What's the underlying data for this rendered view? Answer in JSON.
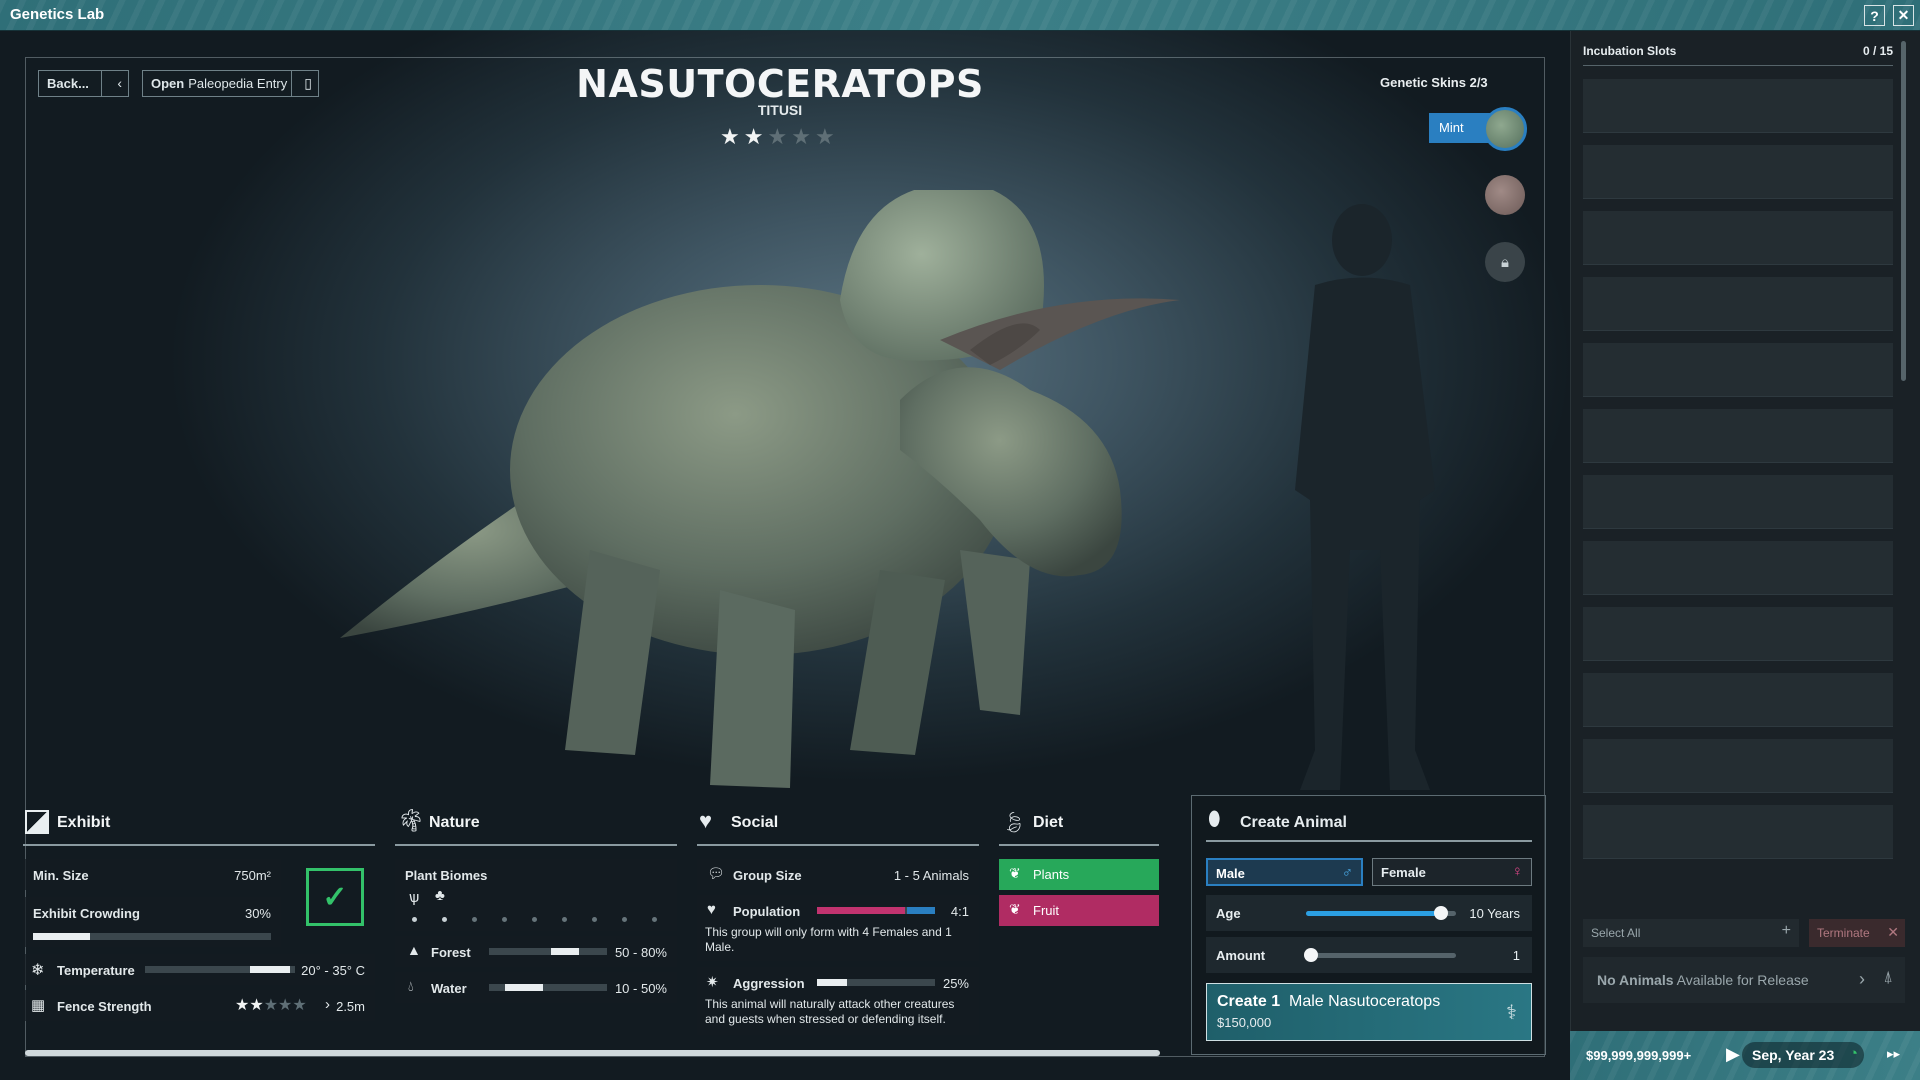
{
  "window": {
    "title": "Genetics Lab",
    "help_label": "?",
    "close_label": "✕"
  },
  "toolbar": {
    "back_label": "Back...",
    "paleopedia_prefix": "Open",
    "paleopedia_label": "Paleopedia Entry"
  },
  "species": {
    "name": "NASUTOCERATOPS",
    "subname": "TITUSI",
    "rating": 2,
    "rating_max": 5
  },
  "skins": {
    "title": "Genetic Skins 2/3",
    "selected_label": "Mint",
    "swatch_colors": [
      "#6f8a76",
      "#8a7470",
      "#3a4449"
    ]
  },
  "exhibit": {
    "title": "Exhibit",
    "min_size_label": "Min. Size",
    "min_size_value": "750m²",
    "crowding_label": "Exhibit Crowding",
    "crowding_value": "30%",
    "crowding_level": 0.3,
    "temperature_label": "Temperature",
    "temperature_value": "20° - 35° C",
    "fence_label": "Fence Strength",
    "fence_stars": 2,
    "fence_value": "2.5m"
  },
  "nature": {
    "title": "Nature",
    "biomes_label": "Plant Biomes",
    "forest_label": "Forest",
    "forest_value": "50 - 80%",
    "water_label": "Water",
    "water_value": "10 - 50%"
  },
  "social": {
    "title": "Social",
    "group_label": "Group Size",
    "group_value": "1 - 5 Animals",
    "population_label": "Population",
    "population_value": "4:1",
    "population_note": "This group will only form with 4 Females and 1 Male.",
    "aggression_label": "Aggression",
    "aggression_value": "25%",
    "aggression_level": 0.25,
    "aggression_note": "This animal will naturally attack other creatures and guests when stressed or defending itself."
  },
  "diet": {
    "title": "Diet",
    "plants_label": "Plants",
    "fruit_label": "Fruit"
  },
  "create": {
    "title": "Create Animal",
    "male_label": "Male",
    "female_label": "Female",
    "age_label": "Age",
    "age_value": "10 Years",
    "age_level": 0.9,
    "amount_label": "Amount",
    "amount_value": "1",
    "amount_level": 0.0,
    "button_prefix": "Create 1",
    "button_label": "Male Nasutoceratops",
    "button_price": "$150,000"
  },
  "incubation": {
    "title": "Incubation Slots",
    "count": "0 / 15",
    "select_all_label": "Select All",
    "terminate_label": "Terminate",
    "release_bold": "No Animals",
    "release_rest": "Available for Release"
  },
  "status": {
    "money": "$99,999,999,999+",
    "date": "Sep, Year 23"
  },
  "colors": {
    "accent_blue": "#2a7fc1",
    "plants_green": "#27a85a",
    "fruit_pink": "#b02c63",
    "check_green": "#33c26a"
  }
}
